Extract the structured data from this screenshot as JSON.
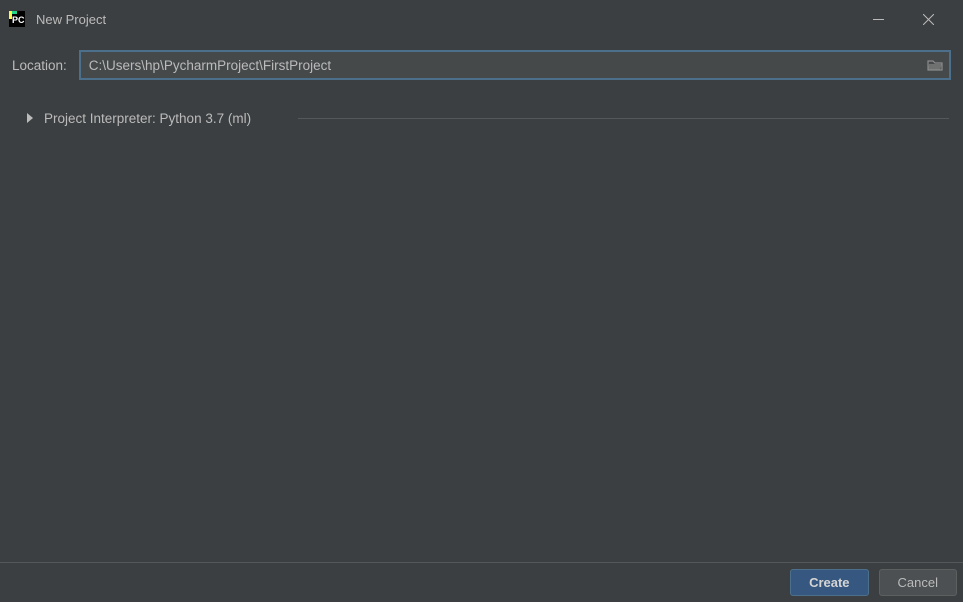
{
  "window": {
    "title": "New Project"
  },
  "form": {
    "location_label": "Location:",
    "location_value": "C:\\Users\\hp\\PycharmProject\\FirstProject",
    "interpreter_label": "Project Interpreter: Python 3.7 (ml)"
  },
  "buttons": {
    "create": "Create",
    "cancel": "Cancel"
  }
}
